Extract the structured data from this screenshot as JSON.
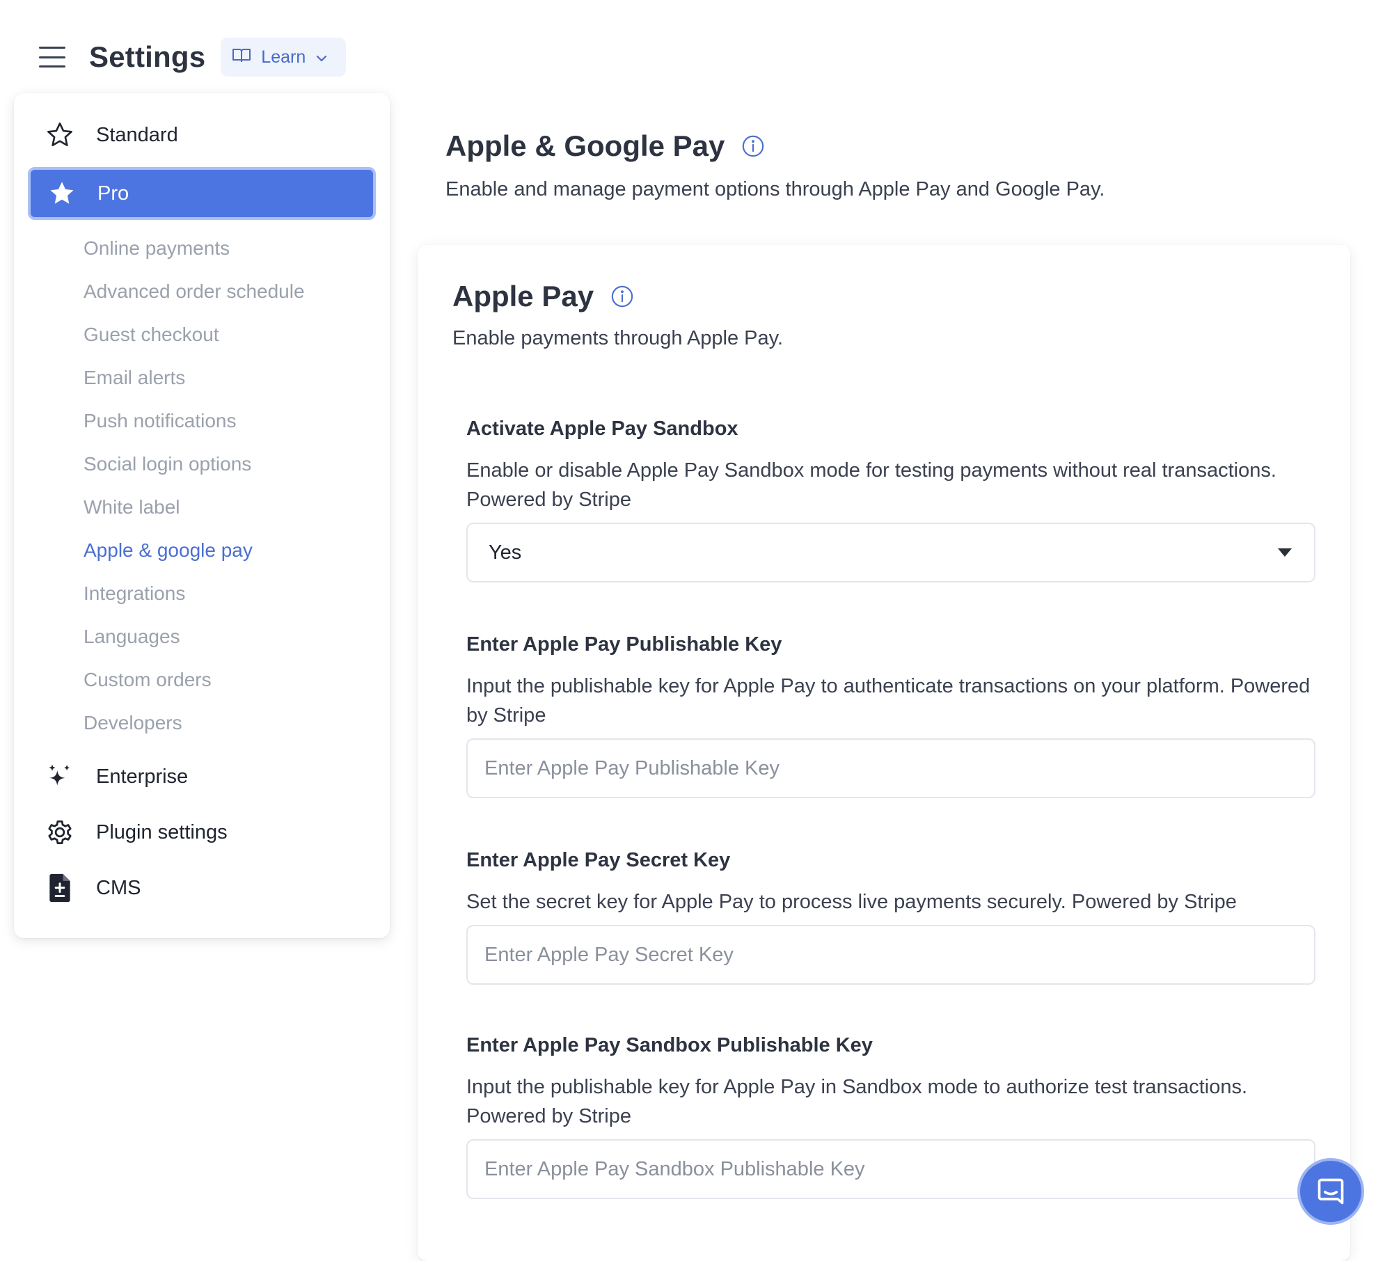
{
  "header": {
    "title": "Settings",
    "learn_label": "Learn",
    "menu_icon": "hamburger-menu-icon",
    "learn_icon": "book-open-icon",
    "learn_caret_icon": "chevron-down-icon"
  },
  "sidebar": {
    "standard": {
      "label": "Standard",
      "icon": "star-outline-icon"
    },
    "pro": {
      "label": "Pro",
      "icon": "star-filled-icon"
    },
    "pro_items": [
      {
        "label": "Online payments"
      },
      {
        "label": "Advanced order schedule"
      },
      {
        "label": "Guest checkout"
      },
      {
        "label": "Email alerts"
      },
      {
        "label": "Push notifications"
      },
      {
        "label": "Social login options"
      },
      {
        "label": "White label"
      },
      {
        "label": "Apple & google pay",
        "active": true
      },
      {
        "label": "Integrations"
      },
      {
        "label": "Languages"
      },
      {
        "label": "Custom orders"
      },
      {
        "label": "Developers"
      }
    ],
    "enterprise": {
      "label": "Enterprise",
      "icon": "sparkles-icon"
    },
    "plugin_settings": {
      "label": "Plugin settings",
      "icon": "gear-icon"
    },
    "cms": {
      "label": "CMS",
      "icon": "document-icon"
    }
  },
  "main": {
    "title": "Apple & Google Pay",
    "description": "Enable and manage payment options through Apple Pay and Google Pay.",
    "section": {
      "title": "Apple Pay",
      "description": "Enable payments through Apple Pay.",
      "fields": {
        "sandbox": {
          "label": "Activate Apple Pay Sandbox",
          "description": "Enable or disable Apple Pay Sandbox mode for testing payments without real transactions. Powered by Stripe",
          "value": "Yes"
        },
        "publishable_key": {
          "label": "Enter Apple Pay Publishable Key",
          "description": "Input the publishable key for Apple Pay to authenticate transactions on your platform. Powered by Stripe",
          "placeholder": "Enter Apple Pay Publishable Key",
          "value": ""
        },
        "secret_key": {
          "label": "Enter Apple Pay Secret Key",
          "description": "Set the secret key for Apple Pay to process live payments securely. Powered by Stripe",
          "placeholder": "Enter Apple Pay Secret Key",
          "value": ""
        },
        "sandbox_publishable_key": {
          "label": "Enter Apple Pay Sandbox Publishable Key",
          "description": "Input the publishable key for Apple Pay in Sandbox mode to authorize test transactions. Powered by Stripe",
          "placeholder": "Enter Apple Pay Sandbox Publishable Key",
          "value": ""
        }
      }
    }
  },
  "chat_widget": {
    "icon": "chat-bubble-icon"
  },
  "colors": {
    "accent": "#4d75e1",
    "active_link": "#4a6fd0",
    "muted_text": "#9aa1ad",
    "learn_bg": "#eef3fc"
  }
}
